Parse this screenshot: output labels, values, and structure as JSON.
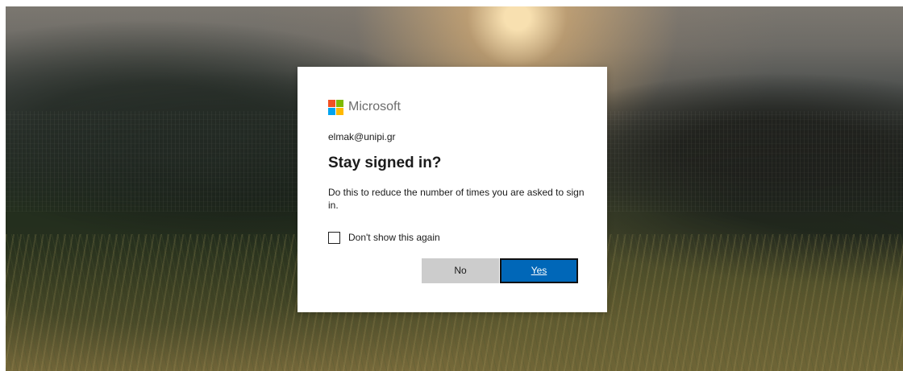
{
  "dialog": {
    "brand_name": "Microsoft",
    "account": "elmak@unipi.gr",
    "title": "Stay signed in?",
    "description": "Do this to reduce the number of times you are asked to sign in.",
    "checkbox_label": "Don't show this again",
    "checkbox_checked": false,
    "no_label": "No",
    "yes_label": "Yes"
  },
  "icons": {
    "logo": "microsoft-logo-icon",
    "checkbox": "checkbox-icon"
  },
  "colors": {
    "logo_red": "#f25022",
    "logo_green": "#7fba00",
    "logo_blue": "#00a4ef",
    "logo_yellow": "#ffb900",
    "primary_button": "#0067b8",
    "secondary_button": "#cccccc"
  }
}
